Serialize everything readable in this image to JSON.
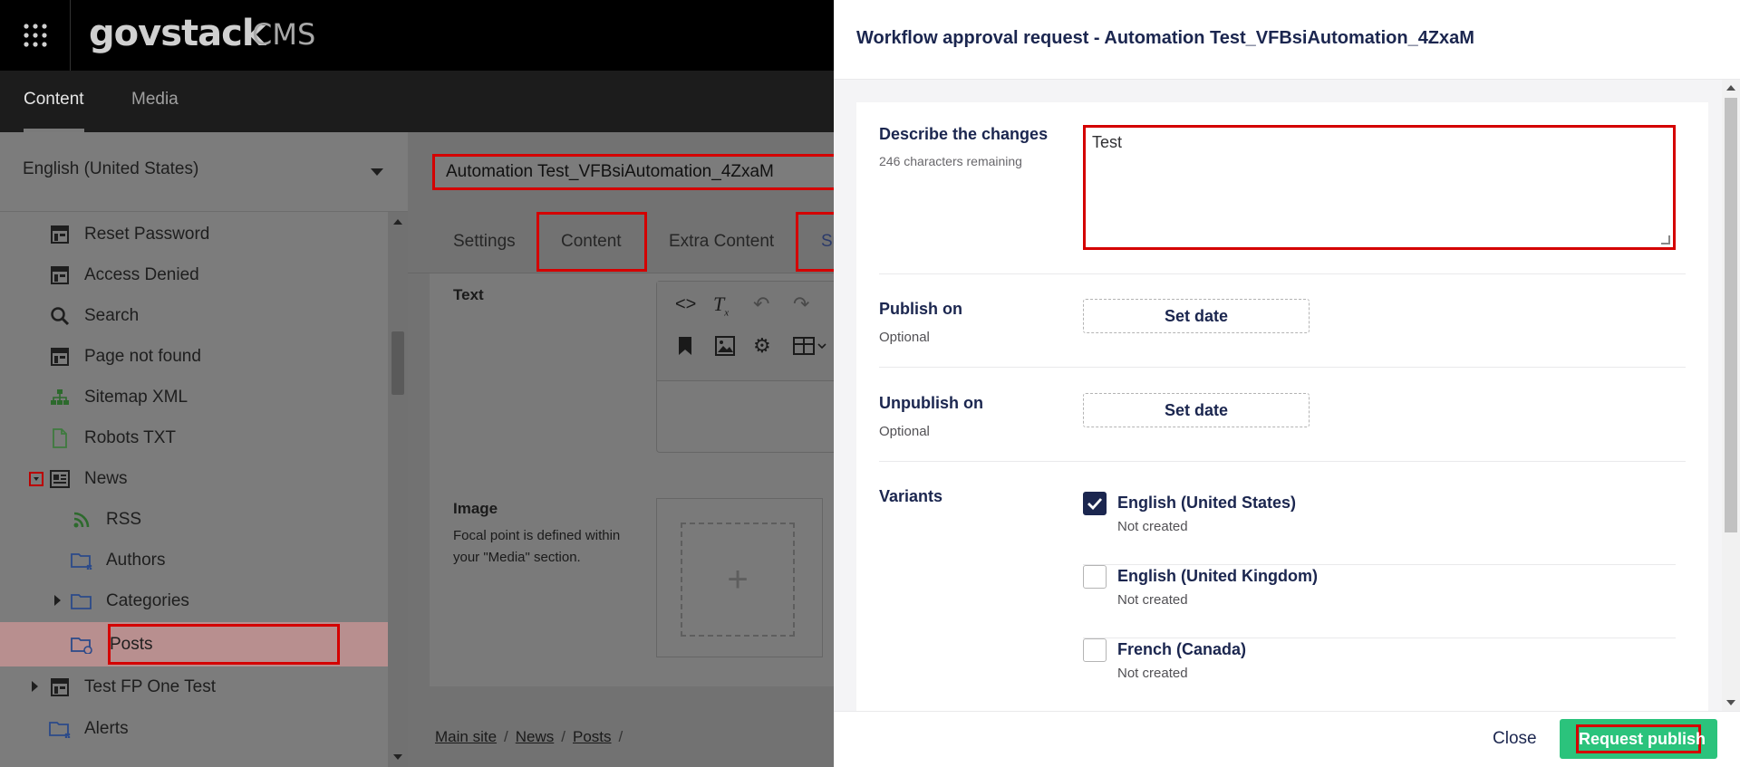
{
  "app": {
    "brand": "govstack",
    "product": "CMS",
    "nav_tabs": [
      {
        "label": "Content",
        "active": true
      },
      {
        "label": "Media",
        "active": false
      }
    ]
  },
  "sidebar": {
    "language": "English (United States)",
    "items": [
      {
        "label": "Reset Password",
        "icon": "page-layout-icon"
      },
      {
        "label": "Access Denied",
        "icon": "page-layout-icon"
      },
      {
        "label": "Search",
        "icon": "search-icon"
      },
      {
        "label": "Page not found",
        "icon": "page-layout-icon"
      },
      {
        "label": "Sitemap XML",
        "icon": "sitemap-icon"
      },
      {
        "label": "Robots TXT",
        "icon": "document-icon"
      },
      {
        "label": "News",
        "icon": "news-icon"
      },
      {
        "label": "RSS",
        "icon": "rss-icon"
      },
      {
        "label": "Authors",
        "icon": "folder-icon"
      },
      {
        "label": "Categories",
        "icon": "folder-icon"
      },
      {
        "label": "Posts",
        "icon": "folder-icon"
      },
      {
        "label": "Test FP One Test",
        "icon": "page-layout-icon"
      },
      {
        "label": "Alerts",
        "icon": "folder-icon"
      }
    ]
  },
  "editor": {
    "page_title": "Automation Test_VFBsiAutomation_4ZxaM",
    "tabs": [
      "Settings",
      "Content",
      "Extra Content",
      "Su"
    ],
    "text_label": "Text",
    "image_label": "Image",
    "image_desc": "Focal point is defined within your \"Media\" section.",
    "breadcrumb": [
      "Main site",
      "News",
      "Posts"
    ]
  },
  "modal": {
    "title": "Workflow approval request - Automation Test_VFBsiAutomation_4ZxaM",
    "describe_label": "Describe the changes",
    "chars_remaining": "246 characters remaining",
    "describe_value": "Test",
    "publish_on_label": "Publish on",
    "unpublish_on_label": "Unpublish on",
    "optional": "Optional",
    "set_date": "Set date",
    "variants_label": "Variants",
    "variants": [
      {
        "name": "English (United States)",
        "status": "Not created",
        "checked": true
      },
      {
        "name": "English (United Kingdom)",
        "status": "Not created",
        "checked": false
      },
      {
        "name": "French (Canada)",
        "status": "Not created",
        "checked": false
      }
    ],
    "close_label": "Close",
    "request_publish_label": "Request publish"
  },
  "colors": {
    "primary": "#1b264f",
    "success": "#2bc37c",
    "highlight": "#d40000"
  }
}
